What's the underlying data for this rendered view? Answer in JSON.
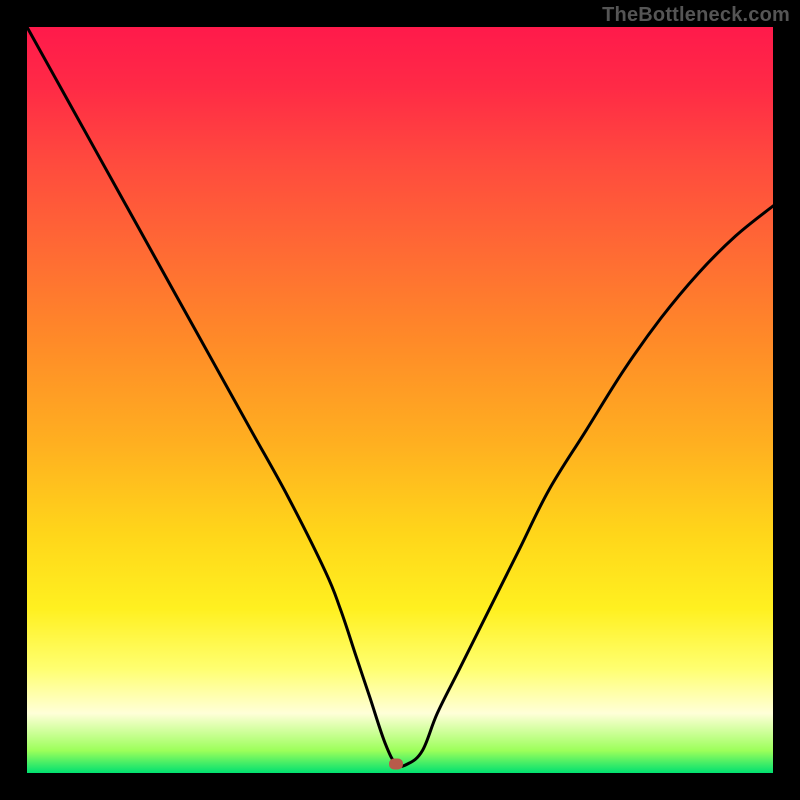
{
  "watermark": "TheBottleneck.com",
  "chart_data": {
    "type": "line",
    "title": "",
    "xlabel": "",
    "ylabel": "",
    "xlim": [
      0,
      100
    ],
    "ylim": [
      0,
      100
    ],
    "x": [
      0,
      5,
      10,
      15,
      20,
      25,
      30,
      35,
      40,
      42,
      44,
      46,
      48,
      49.5,
      51,
      53,
      55,
      58,
      62,
      66,
      70,
      75,
      80,
      85,
      90,
      95,
      100
    ],
    "values": [
      100,
      91,
      82,
      73,
      64,
      55,
      46,
      37,
      27,
      22,
      16,
      10,
      4,
      1.2,
      1.2,
      3,
      8,
      14,
      22,
      30,
      38,
      46,
      54,
      61,
      67,
      72,
      76
    ],
    "marker": {
      "x": 49.5,
      "y": 1.2
    },
    "background_gradient": {
      "stops": [
        {
          "pct": 0,
          "color": "#ff1a4b"
        },
        {
          "pct": 50,
          "color": "#ff9a24"
        },
        {
          "pct": 80,
          "color": "#ffff40"
        },
        {
          "pct": 100,
          "color": "#00e070"
        }
      ]
    }
  },
  "colors": {
    "frame": "#000000",
    "curve": "#000000",
    "marker": "#b85a4a",
    "watermark": "#555555"
  }
}
